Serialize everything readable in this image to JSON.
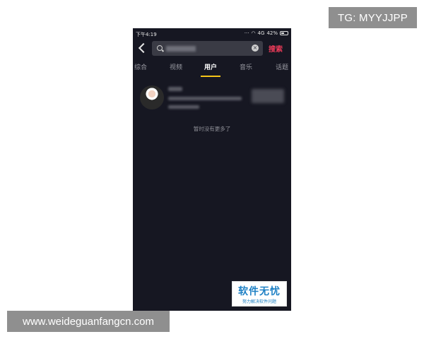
{
  "watermarks": {
    "top_right": "TG: MYYJJPP",
    "bottom_left": "www.weideguanfangcn.com"
  },
  "status_bar": {
    "time": "下午4:19",
    "network": "4G",
    "battery": "42%"
  },
  "search": {
    "button_label": "搜索",
    "clear_glyph": "×"
  },
  "tabs": [
    {
      "label": "综合",
      "active": false
    },
    {
      "label": "视频",
      "active": false
    },
    {
      "label": "用户",
      "active": true
    },
    {
      "label": "音乐",
      "active": false
    },
    {
      "label": "话题",
      "active": false
    }
  ],
  "results": {
    "end_message": "暂时没有更多了"
  },
  "brand": {
    "name": "软件无忧",
    "slogan": "努力解决软件问题"
  },
  "colors": {
    "background": "#161722",
    "accent": "#f03c5a",
    "tab_indicator": "#f5c518",
    "brand": "#1c7fc4"
  },
  "icons": [
    "back-icon",
    "search-icon",
    "clear-icon",
    "wifi-icon",
    "battery-icon"
  ]
}
